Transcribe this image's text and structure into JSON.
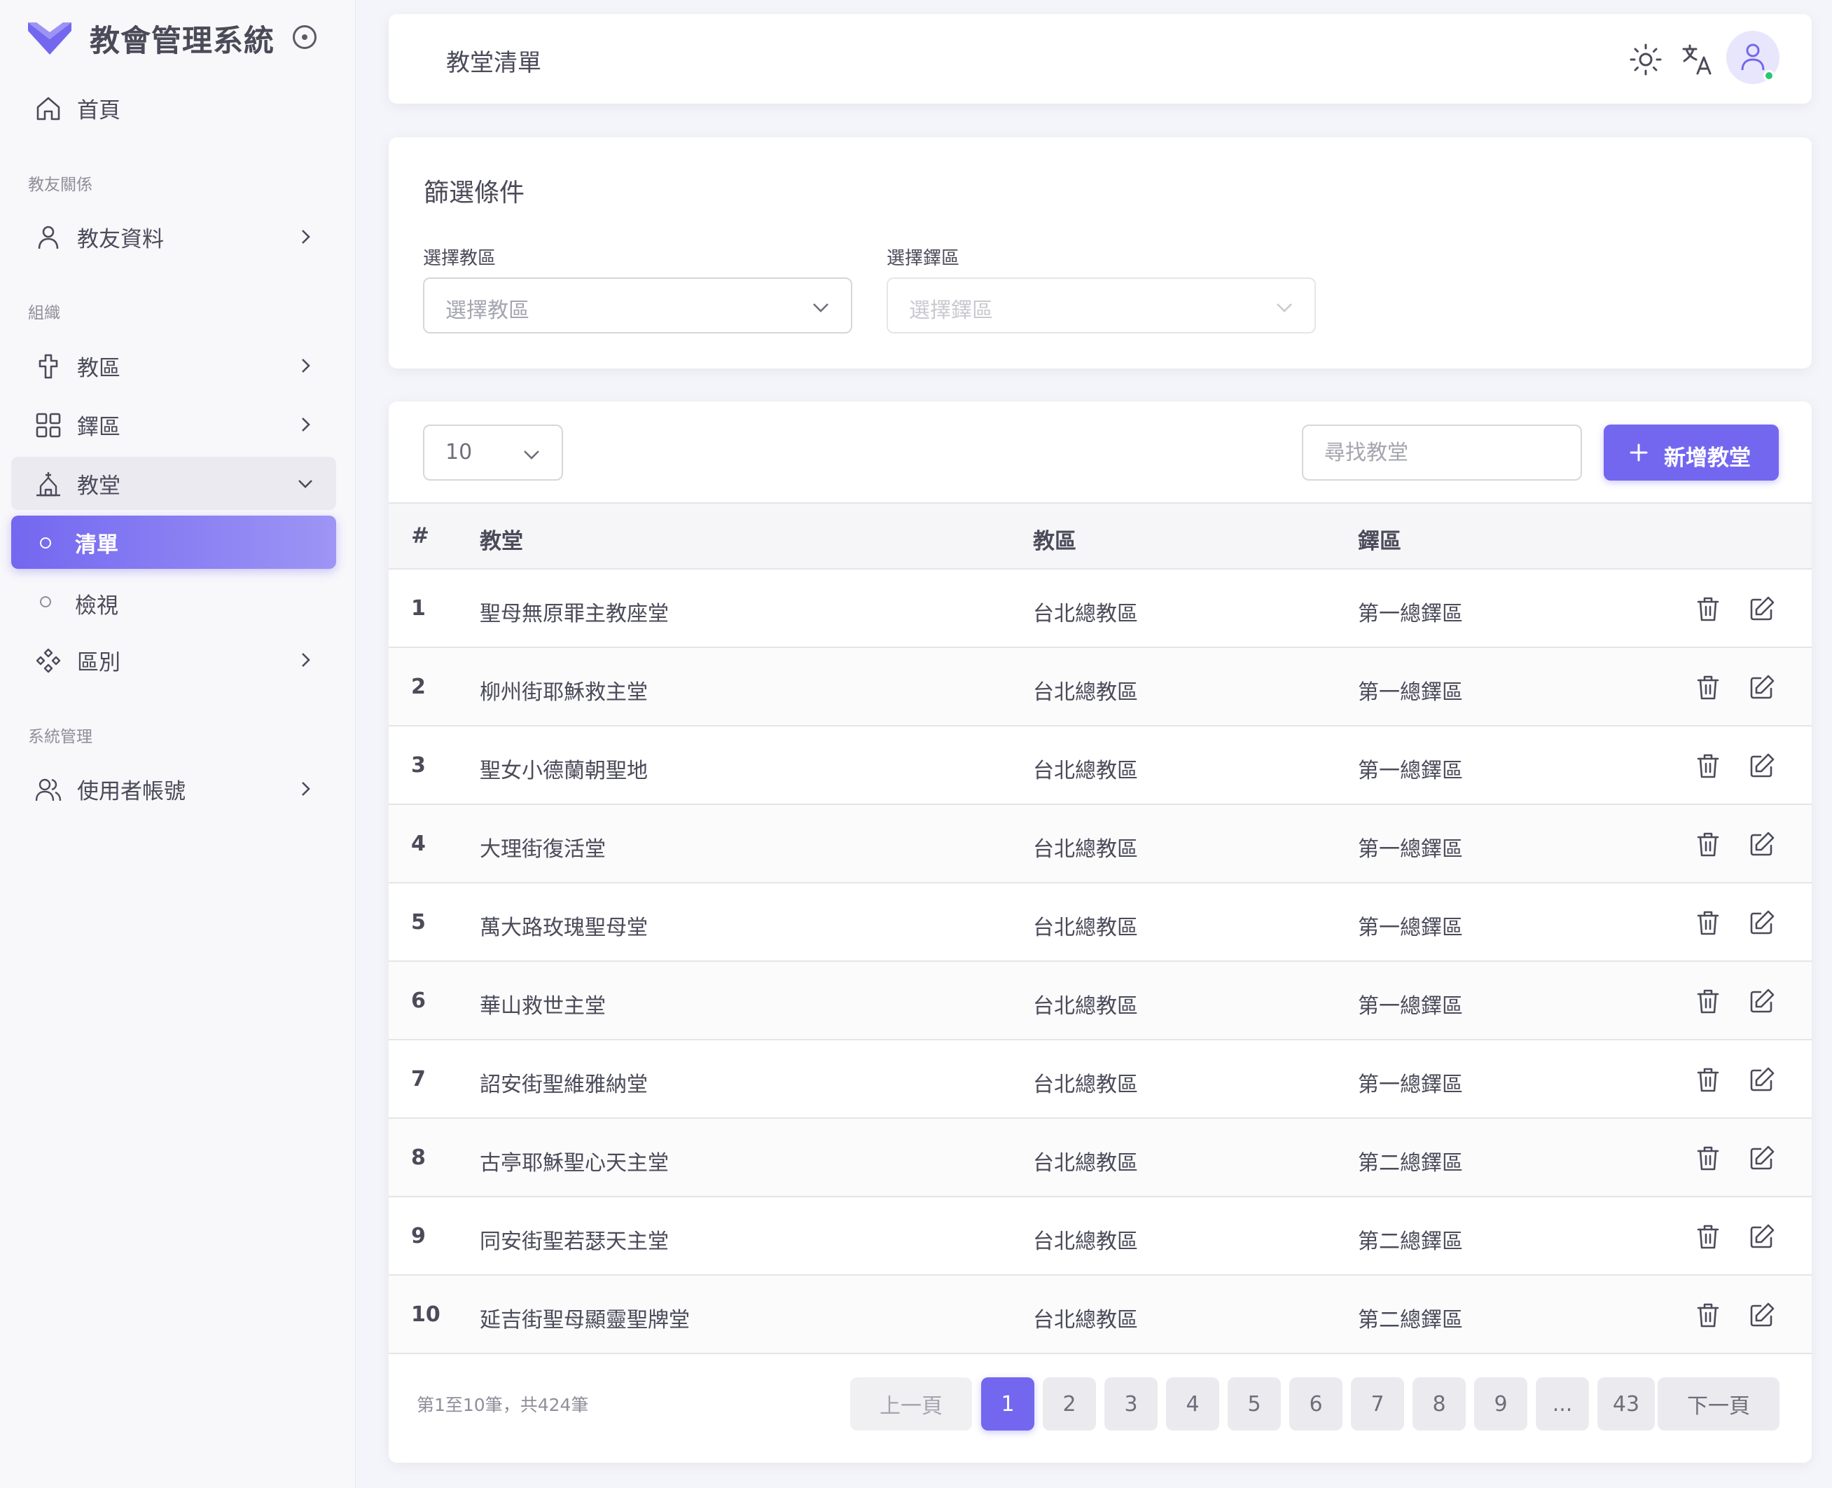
{
  "app": {
    "title": "教會管理系統"
  },
  "sidebar": {
    "home": "首頁",
    "sections": {
      "members": "教友關係",
      "org": "組織",
      "system": "系統管理"
    },
    "items": {
      "member_data": "教友資料",
      "diocese": "教區",
      "deanery": "鐸區",
      "church": "教堂",
      "church_list": "清單",
      "church_view": "檢視",
      "district": "區別",
      "user_accounts": "使用者帳號"
    }
  },
  "header": {
    "title": "教堂清單"
  },
  "filters": {
    "title": "篩選條件",
    "diocese_label": "選擇教區",
    "diocese_placeholder": "選擇教區",
    "deanery_label": "選擇鐸區",
    "deanery_placeholder": "選擇鐸區"
  },
  "toolbar": {
    "page_size": "10",
    "search_placeholder": "尋找教堂",
    "add_label": "新增教堂"
  },
  "table": {
    "columns": {
      "index": "#",
      "church": "教堂",
      "diocese": "教區",
      "deanery": "鐸區"
    },
    "rows": [
      {
        "no": "1",
        "church": "聖母無原罪主教座堂",
        "diocese": "台北總教區",
        "deanery": "第一總鐸區"
      },
      {
        "no": "2",
        "church": "柳州街耶穌救主堂",
        "diocese": "台北總教區",
        "deanery": "第一總鐸區"
      },
      {
        "no": "3",
        "church": "聖女小德蘭朝聖地",
        "diocese": "台北總教區",
        "deanery": "第一總鐸區"
      },
      {
        "no": "4",
        "church": "大理街復活堂",
        "diocese": "台北總教區",
        "deanery": "第一總鐸區"
      },
      {
        "no": "5",
        "church": "萬大路玫瑰聖母堂",
        "diocese": "台北總教區",
        "deanery": "第一總鐸區"
      },
      {
        "no": "6",
        "church": "華山救世主堂",
        "diocese": "台北總教區",
        "deanery": "第一總鐸區"
      },
      {
        "no": "7",
        "church": "詔安街聖維雅納堂",
        "diocese": "台北總教區",
        "deanery": "第一總鐸區"
      },
      {
        "no": "8",
        "church": "古亭耶穌聖心天主堂",
        "diocese": "台北總教區",
        "deanery": "第二總鐸區"
      },
      {
        "no": "9",
        "church": "同安街聖若瑟天主堂",
        "diocese": "台北總教區",
        "deanery": "第二總鐸區"
      },
      {
        "no": "10",
        "church": "延吉街聖母顯靈聖牌堂",
        "diocese": "台北總教區",
        "deanery": "第二總鐸區"
      }
    ]
  },
  "pagination": {
    "info": "第1至10筆，共424筆",
    "prev": "上一頁",
    "next": "下一頁",
    "pages": [
      "1",
      "2",
      "3",
      "4",
      "5",
      "6",
      "7",
      "8",
      "9",
      "...",
      "43"
    ],
    "current": "1"
  },
  "colors": {
    "primary": "#7367f0",
    "online": "#28c76f"
  }
}
